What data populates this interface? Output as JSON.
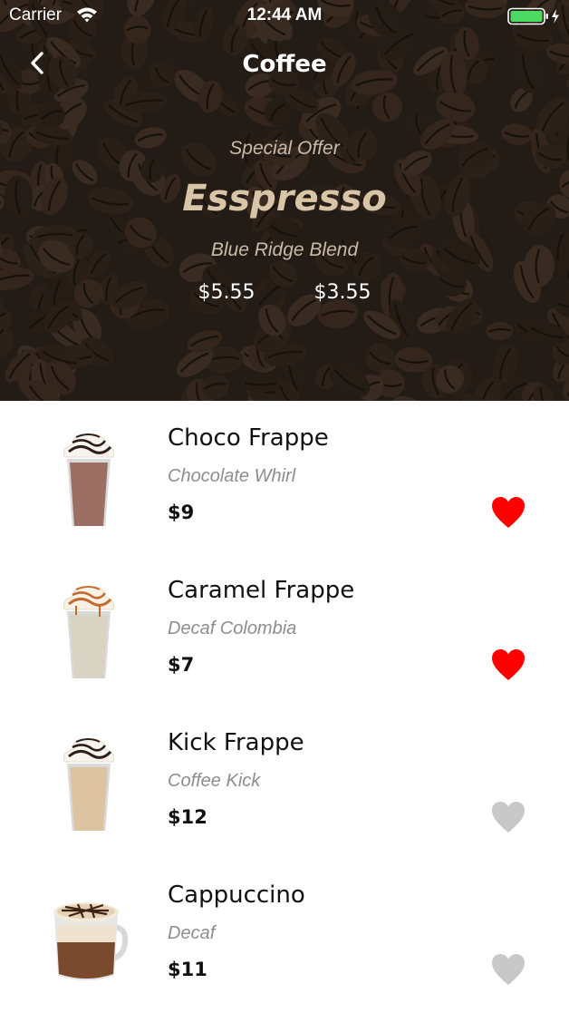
{
  "status_bar": {
    "carrier": "Carrier",
    "time": "12:44 AM"
  },
  "nav": {
    "title": "Coffee",
    "back_icon": "chevron-left-icon"
  },
  "hero": {
    "label": "Special Offer",
    "name": "Esspresso",
    "blend": "Blue Ridge Blend",
    "price_original": "$5.55",
    "price_offer": "$3.55"
  },
  "colors": {
    "favorite_on": "#ff0000",
    "favorite_off": "#c8c8c8",
    "offer_name": "#d8c4a6",
    "battery": "#4cd964"
  },
  "items": [
    {
      "name": "Choco Frappe",
      "description": "Chocolate Whirl",
      "price": "$9",
      "favorite": true,
      "drink": "choco-frappe"
    },
    {
      "name": "Caramel Frappe",
      "description": "Decaf Colombia",
      "price": "$7",
      "favorite": true,
      "drink": "caramel-frappe"
    },
    {
      "name": "Kick Frappe",
      "description": "Coffee Kick",
      "price": "$12",
      "favorite": false,
      "drink": "kick-frappe"
    },
    {
      "name": "Cappuccino",
      "description": "Decaf",
      "price": "$11",
      "favorite": false,
      "drink": "cappuccino"
    }
  ]
}
